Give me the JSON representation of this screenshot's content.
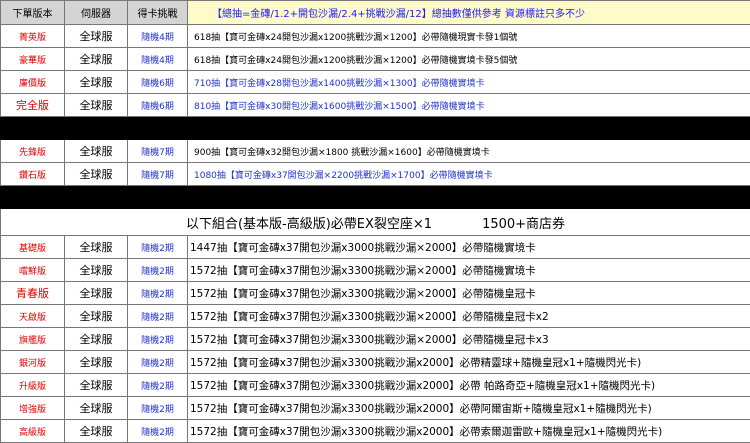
{
  "headers": {
    "version": "下單版本",
    "server": "伺服器",
    "challenge": "得卡挑戰",
    "note": "【總抽=金磚/1.2+開包沙漏/2.4+挑戰沙漏/12】總抽數僅供參考 資源標註只多不少"
  },
  "group1": [
    {
      "version": "菁英版",
      "server": "全球服",
      "challenge": "隨機4期",
      "desc": "618抽【寶可金磚x24開包沙漏x1200挑戰沙漏×1200】必帶隨機現實卡發1個號"
    },
    {
      "version": "豪華版",
      "server": "全球服",
      "challenge": "隨機4期",
      "desc": "618抽【寶可金磚x24開包沙漏x1200挑戰沙漏×1200】必帶隨機實境卡發5個號"
    },
    {
      "version": "廉價版",
      "server": "全球服",
      "challenge": "隨機6期",
      "desc": "710抽【寶可金磚x28開包沙漏x1400挑戰沙漏×1300】必帶隨機實境卡"
    },
    {
      "version": "完全版",
      "server": "全球服",
      "challenge": "隨機6期",
      "desc": "810抽【寶可金磚x30開包沙漏x1600挑戰沙漏×1500】必帶隨機實境卡"
    }
  ],
  "group2": [
    {
      "version": "先鋒版",
      "server": "全球服",
      "challenge": "隨機7期",
      "desc": "900抽【寶可金磚x32開包沙漏×1800 挑戰沙漏×1600】必帶隨機實境卡"
    },
    {
      "version": "鑽石版",
      "server": "全球服",
      "challenge": "隨機7期",
      "desc": "1080抽【寶可金磚x37開包沙漏×2200挑戰沙漏×1700】必帶隨機實境卡"
    }
  ],
  "combo": {
    "title": "以下組合(基本版-高級版)必帶EX裂空座×1",
    "coupon": "1500+商店券"
  },
  "group3": [
    {
      "version": "基礎版",
      "server": "全球服",
      "challenge": "隨機2期",
      "desc": "1447抽【寶可金磚x37開包沙漏x3000挑戰沙漏×2000】必帶隨機實境卡"
    },
    {
      "version": "嚐鮮版",
      "server": "全球服",
      "challenge": "隨機2期",
      "desc": "1572抽【寶可金磚x37開包沙漏x3300挑戰沙漏×2000】必帶隨機實境卡"
    },
    {
      "version": "青春版",
      "server": "全球服",
      "challenge": "隨機2期",
      "desc": "1572抽【寶可金磚x37開包沙漏x3300挑戰沙漏×2000】必帶隨機皇冠卡"
    },
    {
      "version": "天啟版",
      "server": "全球服",
      "challenge": "隨機2期",
      "desc": "1572抽【寶可金磚x37開包沙漏x3300挑戰沙漏×2000】必帶隨機皇冠卡x2"
    },
    {
      "version": "旗艦版",
      "server": "全球服",
      "challenge": "隨機2期",
      "desc": "1572抽【寶可金磚x37開包沙漏x3300挑戰沙漏×2000】必帶隨機皇冠卡x3"
    },
    {
      "version": "銀河版",
      "server": "全球服",
      "challenge": "隨機2期",
      "desc": "1572抽【寶可金磚x37開包沙漏x3300挑戰沙漏x2000】必帶精靈球+隨機皇冠x1+隨機閃光卡)"
    },
    {
      "version": "升級版",
      "server": "全球服",
      "challenge": "隨機2期",
      "desc": "1572抽【寶可金磚x37開包沙漏x3300挑戰沙漏x2000】必帶 帕路奇亞+隨機皇冠x1+隨機閃光卡)"
    },
    {
      "version": "增強版",
      "server": "全球服",
      "challenge": "隨機2期",
      "desc": "1572抽【寶可金磚x37開包沙漏x3300挑戰沙漏x2000】必帶阿爾宙斯+隨機皇冠x1+隨機閃光卡)"
    },
    {
      "version": "高級版",
      "server": "全球服",
      "challenge": "隨機2期",
      "desc": "1572抽【寶可金磚x37開包沙漏x3300挑戰沙漏x2000】必帶索爾迦雷歐+隨機皇冠x1+隨機閃光卡)"
    }
  ]
}
